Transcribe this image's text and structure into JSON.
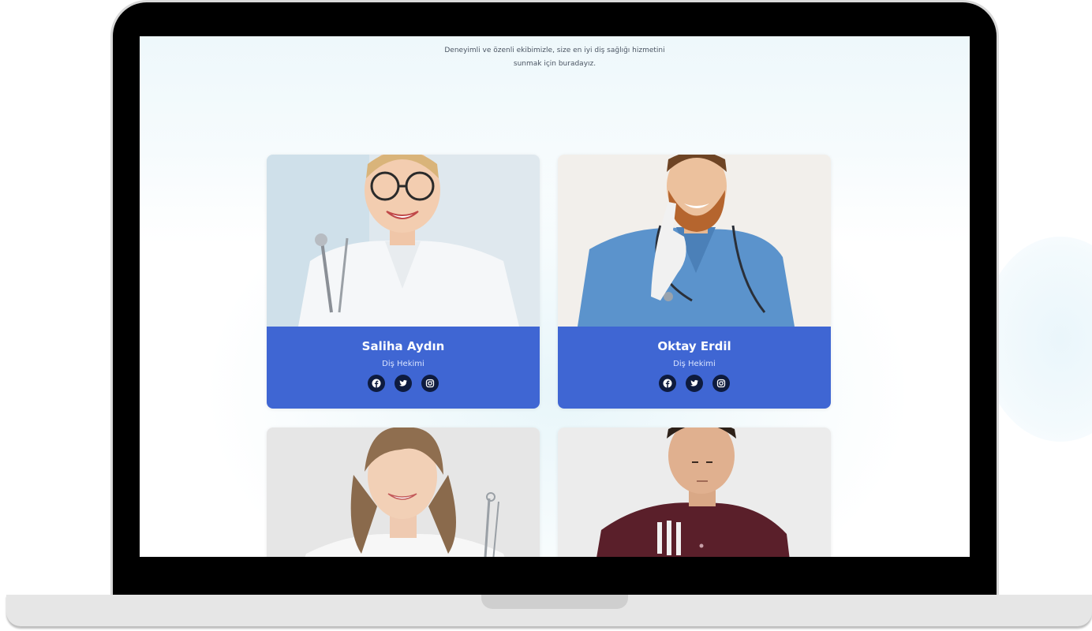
{
  "section": {
    "intro_line1": "Deneyimli ve özenli ekibimizle, size en iyi diş sağlığı hizmetini",
    "intro_line2": "sunmak için buradayız."
  },
  "team": [
    {
      "name": "Saliha Aydın",
      "role": "Diş Hekimi",
      "socials": [
        "facebook-icon",
        "twitter-icon",
        "instagram-icon"
      ]
    },
    {
      "name": "Oktay Erdil",
      "role": "Diş Hekimi",
      "socials": [
        "facebook-icon",
        "twitter-icon",
        "instagram-icon"
      ]
    }
  ],
  "colors": {
    "card_footer": "#3f66d3",
    "social_bg": "#0e1b3e",
    "laptop_frame": "#000000",
    "laptop_base": "#e6e6e6"
  }
}
